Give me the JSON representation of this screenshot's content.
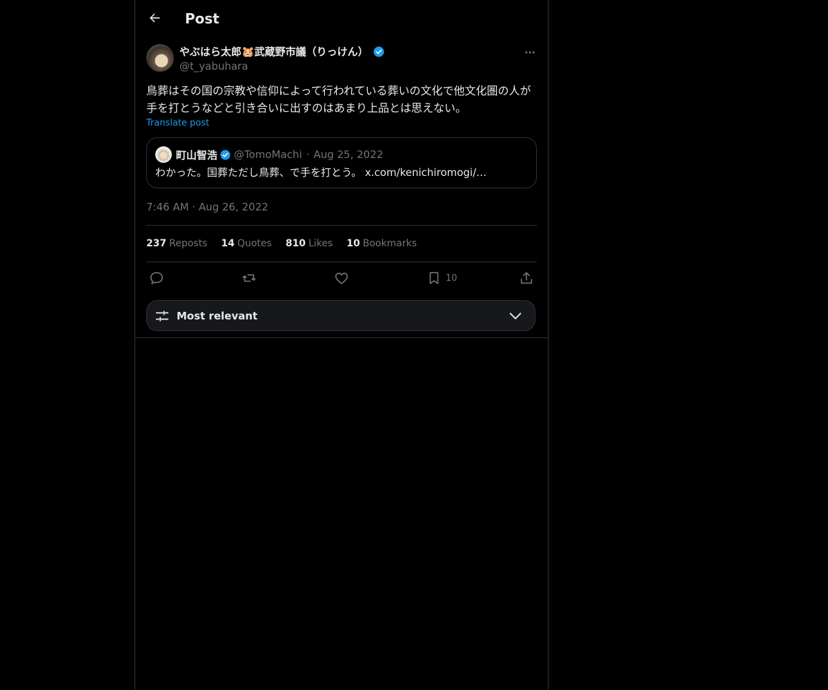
{
  "header": {
    "title": "Post",
    "back_icon": "arrow-left-icon"
  },
  "author": {
    "name": "やぶはら太郎🐹武蔵野市議（りっけん）",
    "handle": "@t_yabuhara",
    "verified": true
  },
  "post": {
    "text": "鳥葬はその国の宗教や信仰によって行われている葬いの文化で他文化圏の人が手を打とうなどと引き合いに出すのはあまり上品とは思えない。",
    "translate_label": "Translate post",
    "timestamp": "7:46 AM · Aug 26, 2022"
  },
  "quote": {
    "name": "町山智浩",
    "handle": "@TomoMachi",
    "date": "Aug 25, 2022",
    "text": "わかった。国葬ただし鳥葬、で手を打とう。",
    "link": "x.com/kenichiromogi/…"
  },
  "stats": [
    {
      "num": "237",
      "label": "Reposts"
    },
    {
      "num": "14",
      "label": "Quotes"
    },
    {
      "num": "810",
      "label": "Likes"
    },
    {
      "num": "10",
      "label": "Bookmarks"
    }
  ],
  "actions": {
    "bookmark_count": "10"
  },
  "sort": {
    "label": "Most relevant"
  },
  "colors": {
    "accent": "#1d9bf0",
    "muted": "#71767b",
    "border": "#2f3336",
    "text": "#e7e9ea"
  }
}
